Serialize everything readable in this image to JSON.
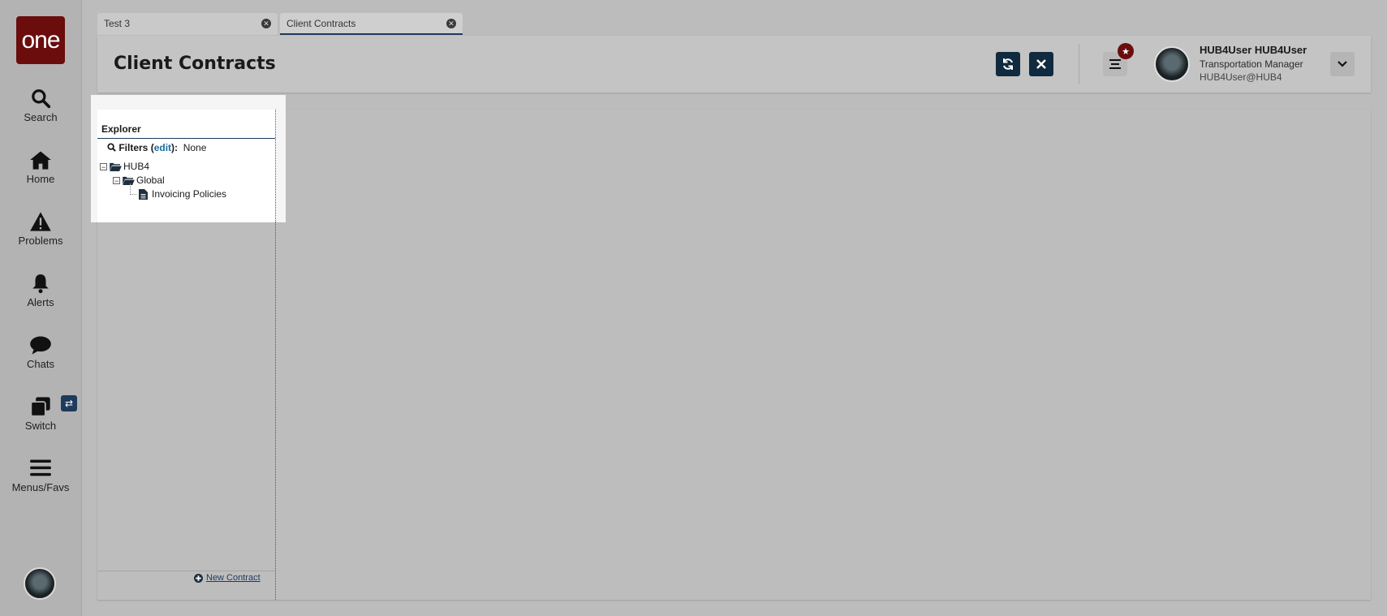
{
  "sidebar": {
    "logo_text": "one",
    "items": [
      {
        "label": "Search",
        "icon": "search-icon"
      },
      {
        "label": "Home",
        "icon": "home-icon"
      },
      {
        "label": "Problems",
        "icon": "warning-icon"
      },
      {
        "label": "Alerts",
        "icon": "bell-icon"
      },
      {
        "label": "Chats",
        "icon": "chat-icon"
      },
      {
        "label": "Switch",
        "icon": "switch-icon"
      },
      {
        "label": "Menus/Favs",
        "icon": "menu-icon"
      }
    ],
    "switch_badge": "⇄"
  },
  "tabs": [
    {
      "label": "Test 3"
    },
    {
      "label": "Client Contracts"
    }
  ],
  "header": {
    "title": "Client Contracts",
    "user": {
      "name": "HUB4User HUB4User",
      "role": "Transportation Manager",
      "email": "HUB4User@HUB4"
    }
  },
  "explorer": {
    "title": "Explorer",
    "filters_label": "Filters",
    "filters_edit": "edit",
    "filters_value": "None",
    "tree": {
      "root": "HUB4",
      "child": "Global",
      "leaf": "Invoicing Policies"
    },
    "new_contract": "New Contract"
  },
  "colors": {
    "brand": "#6b0d0d",
    "accent": "#102a3f",
    "link": "#1a6a9a"
  }
}
